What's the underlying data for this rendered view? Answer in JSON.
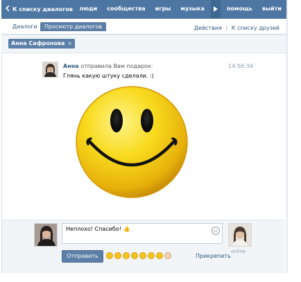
{
  "topbar": {
    "back_label": "К списку диалогов",
    "nav": [
      "люди",
      "сообщества",
      "игры",
      "музыка",
      "помощь",
      "выйти"
    ]
  },
  "tabs": {
    "dialogs": "Диалоги",
    "view": "Просмотр диалогов"
  },
  "actions": {
    "actions_label": "Действия",
    "separator": "|",
    "friends_label": "К списку друзей"
  },
  "chip": {
    "name": "Анна Сафронова",
    "close": "×"
  },
  "message": {
    "sender": "Анна",
    "action": "отправила Вам подарок:",
    "time": "14:56:34",
    "text": "Глянь какую штуку сделали. :)"
  },
  "compose": {
    "value": "Неплохо! Спасибо! 👍",
    "send_label": "Отправить",
    "attach_label": "Прикрепить",
    "peer_status": "online"
  },
  "colors": {
    "header": "#4d76a2",
    "accent": "#5b7fa6",
    "link": "#2b587a",
    "smiley": "#f6d21a"
  }
}
